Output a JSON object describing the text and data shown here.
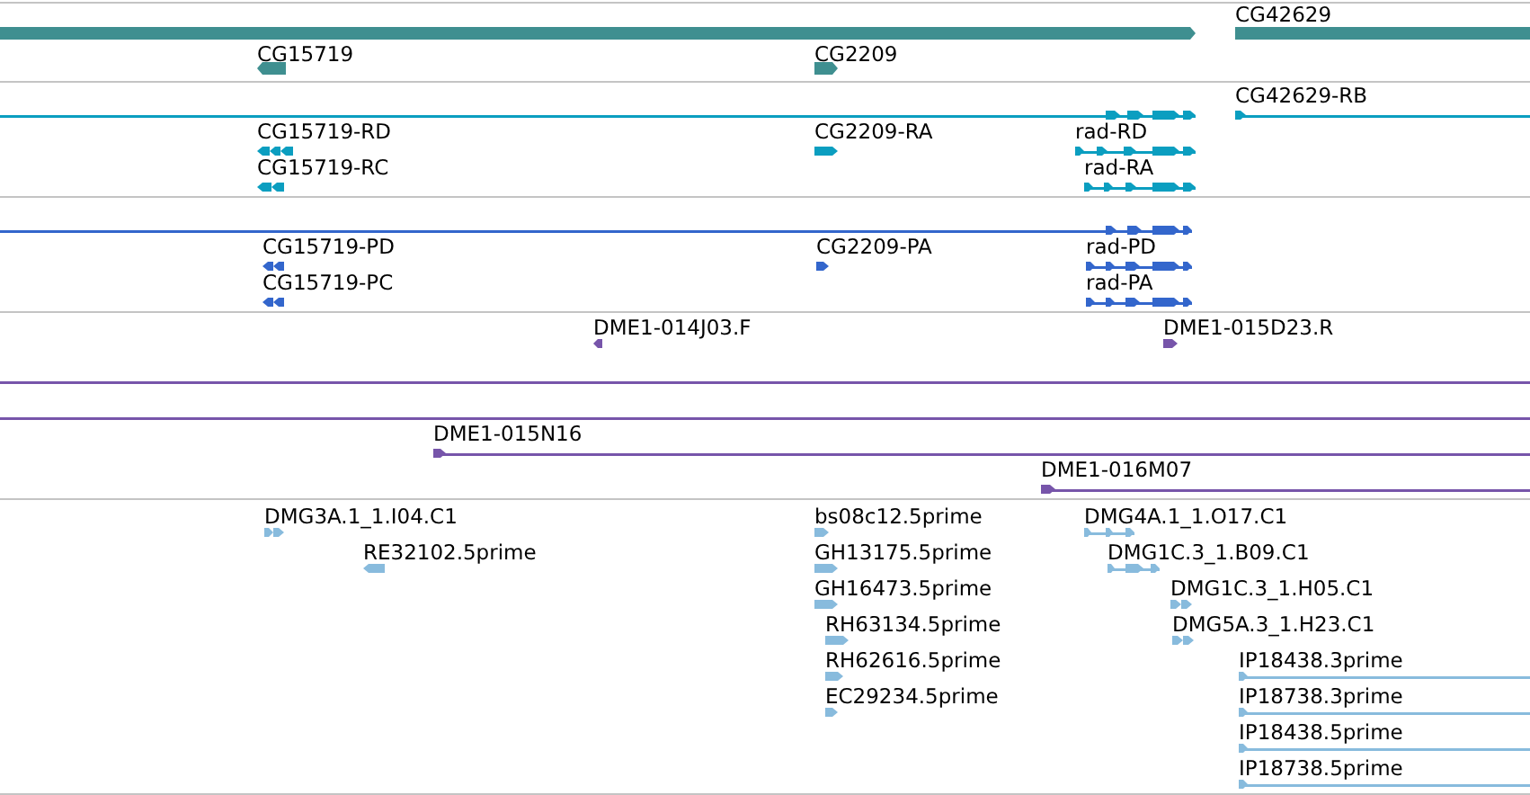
{
  "tracks": [
    {
      "kind": "gene",
      "color": "#3f8f90",
      "features": [
        {
          "reverse": false
        },
        {
          "label": "CG15719",
          "reverse": true
        },
        {
          "label": "CG2209",
          "reverse": false
        },
        {
          "label": "CG42629",
          "reverse": false
        }
      ]
    },
    {
      "kind": "transcript",
      "color": "#0b9ec0",
      "features": [
        {
          "reverse": false
        },
        {
          "label": "CG42629-RB",
          "reverse": false
        },
        {
          "label": "CG15719-RD",
          "reverse": true
        },
        {
          "label": "CG2209-RA",
          "reverse": false
        },
        {
          "label": "rad-RD",
          "reverse": false
        },
        {
          "label": "CG15719-RC",
          "reverse": true
        },
        {
          "label": "rad-RA",
          "reverse": false
        }
      ]
    },
    {
      "kind": "protein",
      "color": "#3366cc",
      "features": [
        {
          "reverse": false
        },
        {
          "label": "CG15719-PD",
          "reverse": true
        },
        {
          "label": "CG2209-PA",
          "reverse": false
        },
        {
          "label": "rad-PD",
          "reverse": false
        },
        {
          "label": "CG15719-PC",
          "reverse": true
        },
        {
          "label": "rad-PA",
          "reverse": false
        }
      ]
    },
    {
      "kind": "clone",
      "color": "#7755aa",
      "features": [
        {
          "kind": "read",
          "label": "DME1-014J03.F",
          "reverse": true
        },
        {
          "kind": "read",
          "label": "DME1-015D23.R",
          "reverse": false
        },
        {
          "kind": "span"
        },
        {
          "kind": "span"
        },
        {
          "kind": "read",
          "label": "DME1-015N16",
          "reverse": false
        },
        {
          "kind": "read",
          "label": "DME1-016M07",
          "reverse": false
        }
      ]
    },
    {
      "kind": "est",
      "color": "#88bbdd",
      "features": [
        {
          "label": "DMG3A.1_1.I04.C1",
          "reverse": false
        },
        {
          "label": "RE32102.5prime",
          "reverse": true
        },
        {
          "label": "bs08c12.5prime",
          "reverse": false
        },
        {
          "label": "GH13175.5prime",
          "reverse": false
        },
        {
          "label": "GH16473.5prime",
          "reverse": false
        },
        {
          "label": "RH63134.5prime",
          "reverse": false
        },
        {
          "label": "RH62616.5prime",
          "reverse": false
        },
        {
          "label": "EC29234.5prime",
          "reverse": false
        },
        {
          "label": "DMG4A.1_1.O17.C1",
          "reverse": false
        },
        {
          "label": "DMG1C.3_1.B09.C1",
          "reverse": false
        },
        {
          "label": "DMG1C.3_1.H05.C1",
          "reverse": false
        },
        {
          "label": "DMG5A.3_1.H23.C1",
          "reverse": false
        },
        {
          "label": "IP18438.3prime",
          "reverse": false
        },
        {
          "label": "IP18738.3prime",
          "reverse": false
        },
        {
          "label": "IP18438.5prime",
          "reverse": false
        },
        {
          "label": "IP18738.5prime",
          "reverse": false
        }
      ]
    }
  ]
}
